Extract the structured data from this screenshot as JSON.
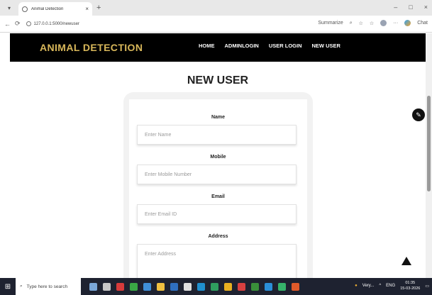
{
  "browser": {
    "tab_title": "Animal Detection",
    "tab_close": "×",
    "new_tab": "+",
    "url": "127.0.0.1:5000/newuser",
    "summarize": "Summarize",
    "chat": "Chat",
    "window_controls": {
      "minimize": "–",
      "maximize": "□",
      "close": "×"
    }
  },
  "site": {
    "brand": "ANIMAL DETECTION",
    "nav": [
      "HOME",
      "ADMINLOGIN",
      "USER LOGIN",
      "NEW USER"
    ],
    "brand_color": "#d8b75a"
  },
  "form": {
    "title": "NEW USER",
    "fields": [
      {
        "label": "Name",
        "placeholder": "Enter Name"
      },
      {
        "label": "Mobile",
        "placeholder": "Enter Mobile Number"
      },
      {
        "label": "Email",
        "placeholder": "Enter Email ID"
      },
      {
        "label": "Address",
        "placeholder": "Enter Address"
      }
    ]
  },
  "taskbar": {
    "search_placeholder": "Type here to search",
    "weather": "Very...",
    "lang": "ENG",
    "time": "01:35",
    "date": "15-03-2026"
  }
}
